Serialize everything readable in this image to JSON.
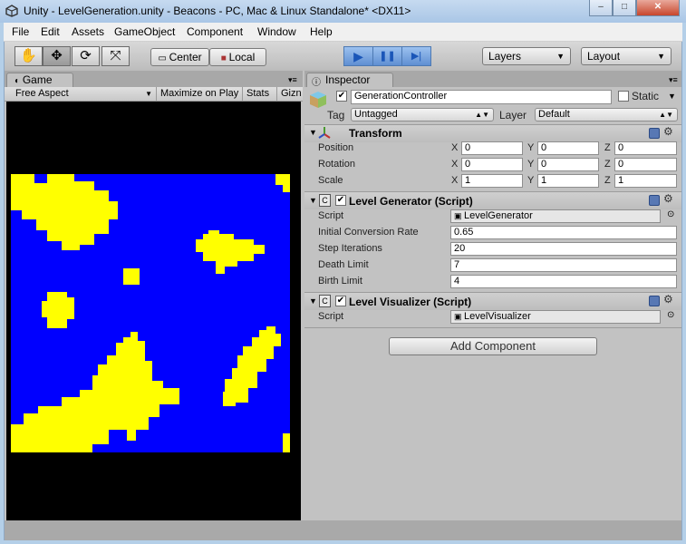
{
  "window": {
    "title": "Unity - LevelGeneration.unity - Beacons - PC, Mac & Linux Standalone* <DX11>",
    "minimize": "–",
    "maximize": "□",
    "close": "✕"
  },
  "menu": [
    "File",
    "Edit",
    "Assets",
    "GameObject",
    "Component",
    "Window",
    "Help"
  ],
  "toolbar": {
    "tools": [
      "✋",
      "✥",
      "⟳",
      "⤧"
    ],
    "pivot": "Center",
    "space": "Local",
    "play": "▶",
    "pause": "❚❚",
    "step": "▶|",
    "layers": "Layers",
    "layout": "Layout"
  },
  "game": {
    "tab": "Game",
    "aspect": "Free Aspect",
    "maximize": "Maximize on Play",
    "stats": "Stats",
    "gizmos": "Gizn"
  },
  "inspector": {
    "tab": "Inspector",
    "object_name": "GenerationController",
    "static_label": "Static",
    "tag_label": "Tag",
    "tag_value": "Untagged",
    "layer_label": "Layer",
    "layer_value": "Default",
    "transform": {
      "title": "Transform",
      "rows": [
        {
          "label": "Position",
          "x": "0",
          "y": "0",
          "z": "0"
        },
        {
          "label": "Rotation",
          "x": "0",
          "y": "0",
          "z": "0"
        },
        {
          "label": "Scale",
          "x": "1",
          "y": "1",
          "z": "1"
        }
      ]
    },
    "generator": {
      "title": "Level Generator (Script)",
      "script_label": "Script",
      "script_value": "LevelGenerator",
      "rows": [
        {
          "label": "Initial Conversion Rate",
          "value": "0.65"
        },
        {
          "label": "Step Iterations",
          "value": "20"
        },
        {
          "label": "Death Limit",
          "value": "7"
        },
        {
          "label": "Birth Limit",
          "value": "4"
        }
      ]
    },
    "visualizer": {
      "title": "Level Visualizer (Script)",
      "script_label": "Script",
      "script_value": "LevelVisualizer"
    },
    "add_component": "Add Component"
  },
  "axes": {
    "x": "X",
    "y": "Y",
    "z": "Z"
  },
  "colors": {
    "map_wall": "#ffff00",
    "map_floor": "#0000ff"
  }
}
